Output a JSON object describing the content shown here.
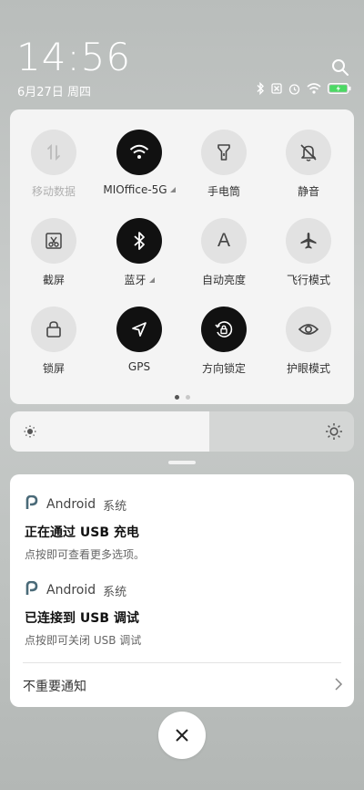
{
  "status_bar": {
    "time": "14:56",
    "date": "6月27日 周四",
    "icons": [
      "bluetooth-icon",
      "sim-off-icon",
      "alarm-icon",
      "wifi-icon",
      "battery-charging-icon"
    ]
  },
  "quick_settings": {
    "tiles": [
      {
        "label": "移动数据",
        "icon": "mobile-data-icon",
        "on": false,
        "disabled": true
      },
      {
        "label": "MIOffice-5G",
        "icon": "wifi-icon",
        "on": true,
        "expandable": true
      },
      {
        "label": "手电筒",
        "icon": "flashlight-icon",
        "on": false
      },
      {
        "label": "静音",
        "icon": "bell-off-icon",
        "on": false
      },
      {
        "label": "截屏",
        "icon": "screenshot-icon",
        "on": false
      },
      {
        "label": "蓝牙",
        "icon": "bluetooth-icon",
        "on": true,
        "expandable": true
      },
      {
        "label": "自动亮度",
        "icon": "auto-brightness-icon",
        "on": false,
        "glyph": "A"
      },
      {
        "label": "飞行模式",
        "icon": "airplane-icon",
        "on": false
      },
      {
        "label": "锁屏",
        "icon": "lock-icon",
        "on": false
      },
      {
        "label": "GPS",
        "icon": "location-arrow-icon",
        "on": true
      },
      {
        "label": "方向锁定",
        "icon": "rotation-lock-icon",
        "on": true
      },
      {
        "label": "护眼模式",
        "icon": "eye-icon",
        "on": false
      }
    ],
    "page_count": 2,
    "active_page": 1
  },
  "brightness": {
    "level": 0.58
  },
  "notifications": [
    {
      "app": "Android",
      "source": "系统",
      "title": "正在通过 USB 充电",
      "text": "点按即可查看更多选项。"
    },
    {
      "app": "Android",
      "source": "系统",
      "title": "已连接到 USB 调试",
      "text": "点按即可关闭 USB 调试"
    }
  ],
  "unimportant_label": "不重要通知",
  "colors": {
    "tile_on": "#111111",
    "tile_off": "#e2e2e2",
    "panel": "#f4f4f4"
  }
}
